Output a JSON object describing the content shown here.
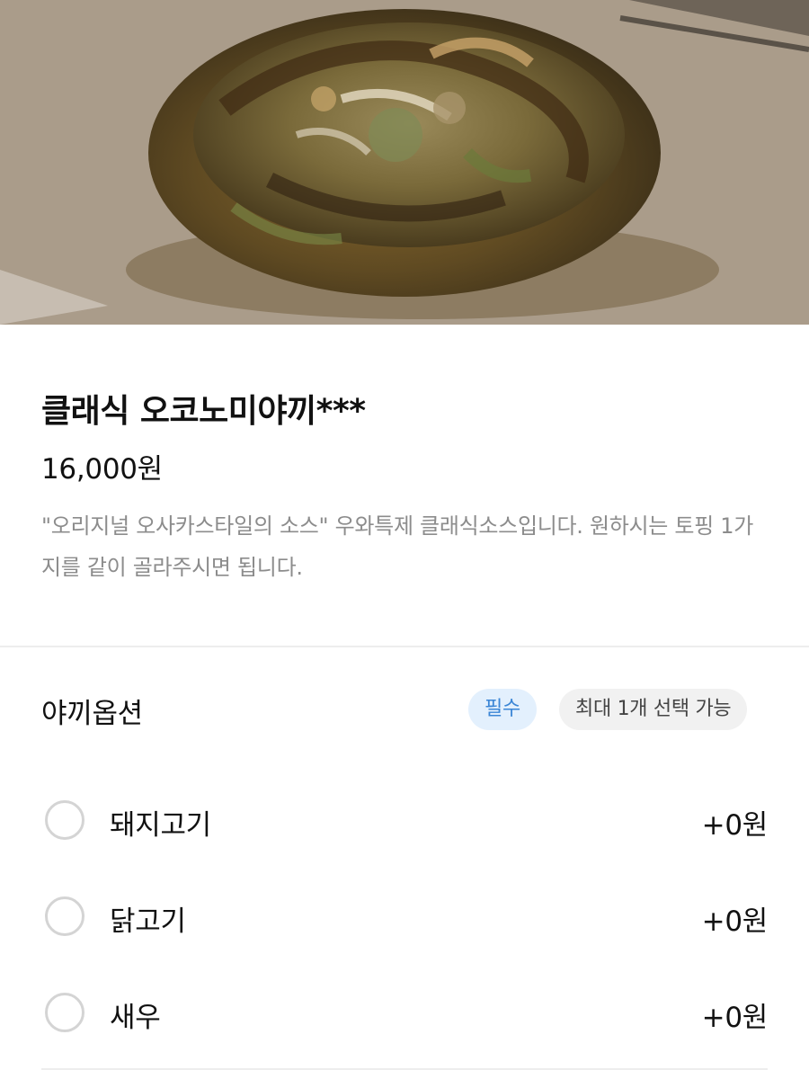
{
  "product": {
    "title": "클래식 오코노미야끼***",
    "price": "16,000원",
    "description": "\"오리지널 오사카스타일의 소스\" 우와특제 클래식소스입니다.  원하시는 토핑 1가지를 같이 골라주시면 됩니다."
  },
  "option_group": {
    "title": "야끼옵션",
    "required_badge": "필수",
    "max_badge": "최대 1개 선택 가능",
    "options": [
      {
        "label": "돼지고기",
        "price": "+0원",
        "selected": false
      },
      {
        "label": "닭고기",
        "price": "+0원",
        "selected": false
      },
      {
        "label": "새우",
        "price": "+0원",
        "selected": false
      }
    ]
  },
  "colors": {
    "required_badge_bg": "#e3f0fd",
    "required_badge_text": "#3b86d6",
    "max_badge_bg": "#f1f1f1",
    "description_text": "#8c8c8c",
    "radio_border": "#d4d4d4"
  }
}
